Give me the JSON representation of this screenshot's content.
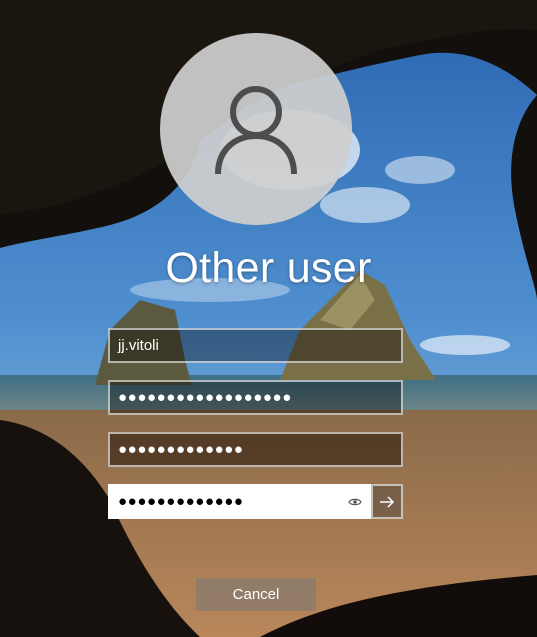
{
  "title": "Other user",
  "fields": {
    "username_value": "jj.vitoli",
    "current_password_mask": "●●●●●●●●●●●●●●●●●●",
    "new_password_mask": "●●●●●●●●●●●●●",
    "confirm_password_mask": "●●●●●●●●●●●●●"
  },
  "icons": {
    "avatar": "user-silhouette-icon",
    "reveal": "eye-icon",
    "submit": "arrow-right-icon"
  },
  "buttons": {
    "cancel_label": "Cancel"
  },
  "colors": {
    "text": "#ffffff",
    "field_border": "#bfbfbf",
    "avatar_bg": "#cfcfcf"
  }
}
